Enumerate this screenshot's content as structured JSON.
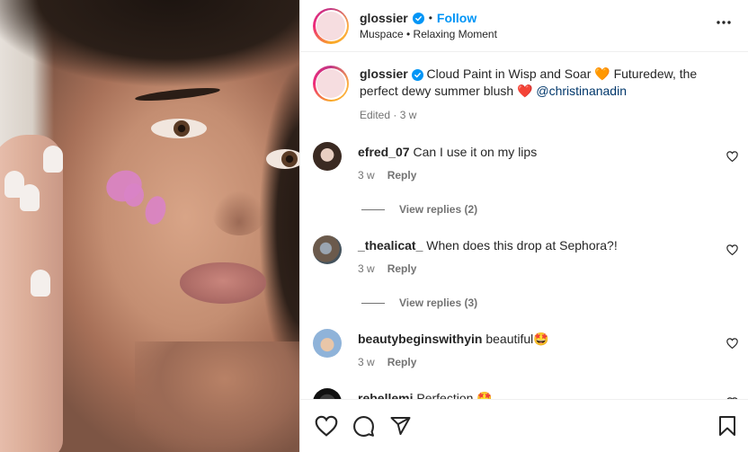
{
  "post": {
    "account": "glossier",
    "follow_label": "Follow",
    "dot": "•",
    "subtitle": "Muspace • Relaxing Moment"
  },
  "caption": {
    "username": "glossier",
    "text": "Cloud Paint in Wisp and Soar 🧡 Futuredew, the perfect dewy summer blush ❤️",
    "mention": "@christinanadin",
    "meta": "Edited · 3 w"
  },
  "comments": [
    {
      "username": "efred_07",
      "text": "Can I use it on my lips",
      "time": "3 w",
      "reply_label": "Reply",
      "view_replies": "View replies (2)"
    },
    {
      "username": "_thealicat_",
      "text": "When does this drop at Sephora?!",
      "time": "3 w",
      "reply_label": "Reply",
      "view_replies": "View replies (3)"
    },
    {
      "username": "beautybeginswithyin",
      "text": "beautiful🤩",
      "time": "3 w",
      "reply_label": "Reply"
    },
    {
      "username": "rebellemj",
      "text": "Perfection 🤩"
    }
  ],
  "colors": {
    "accent": "#0095f6",
    "text": "#262626",
    "muted": "#737373",
    "mention": "#00376b",
    "blush": "#d983c6"
  },
  "icons": {
    "verified": "verified-badge-icon",
    "more": "more-options-icon",
    "like": "heart-icon",
    "comment": "comment-icon",
    "share": "share-icon",
    "save": "bookmark-icon"
  }
}
